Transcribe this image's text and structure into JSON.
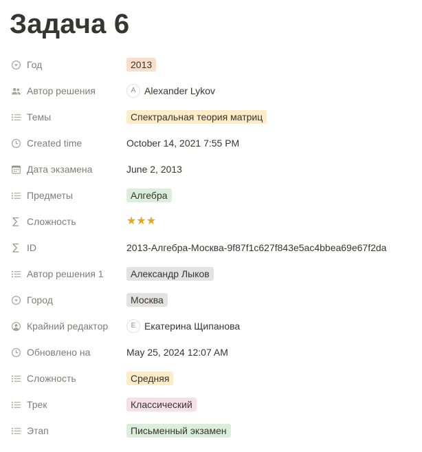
{
  "page": {
    "title": "Задача 6"
  },
  "properties": [
    {
      "label": "Год",
      "icon": "select-icon",
      "kind": "tag",
      "value": "2013",
      "color": "#fadec9"
    },
    {
      "label": "Автор решения",
      "icon": "people-icon",
      "kind": "person",
      "value": "Alexander Lykov",
      "initial": "A"
    },
    {
      "label": "Темы",
      "icon": "list-icon",
      "kind": "tag",
      "value": "Спектральная теория матриц",
      "color": "#fdecc8"
    },
    {
      "label": "Created time",
      "icon": "clock-icon",
      "kind": "text",
      "value": "October 14, 2021 7:55 PM"
    },
    {
      "label": "Дата экзамена",
      "icon": "calendar-icon",
      "kind": "text",
      "value": "June 2, 2013"
    },
    {
      "label": "Предметы",
      "icon": "list-icon",
      "kind": "tag",
      "value": "Алгебра",
      "color": "#dbeddb"
    },
    {
      "label": "Сложность",
      "icon": "sigma-icon",
      "kind": "stars",
      "value": "★★★"
    },
    {
      "label": "ID",
      "icon": "sigma-icon",
      "kind": "text",
      "value": "2013-Алгебра-Москва-9f87f1c627f843e5ac4bbea69e67f2da"
    },
    {
      "label": "Автор решения 1",
      "icon": "list-icon",
      "kind": "tag",
      "value": "Александр Лыков",
      "color": "#e3e2e0"
    },
    {
      "label": "Город",
      "icon": "select-icon",
      "kind": "tag",
      "value": "Москва",
      "color": "#e3e2e0"
    },
    {
      "label": "Крайний редактор",
      "icon": "person-circle-icon",
      "kind": "person",
      "value": "Екатерина Щипанова",
      "initial": "Е"
    },
    {
      "label": "Обновлено на",
      "icon": "clock-icon",
      "kind": "text",
      "value": "May 25, 2024 12:07 AM"
    },
    {
      "label": "Сложность",
      "icon": "list-icon",
      "kind": "tag",
      "value": "Средняя",
      "color": "#fdecc8"
    },
    {
      "label": "Трек",
      "icon": "list-icon",
      "kind": "tag",
      "value": "Классический",
      "color": "#f5e0e9"
    },
    {
      "label": "Этап",
      "icon": "list-icon",
      "kind": "tag",
      "value": "Письменный экзамен",
      "color": "#dbeddb"
    }
  ]
}
